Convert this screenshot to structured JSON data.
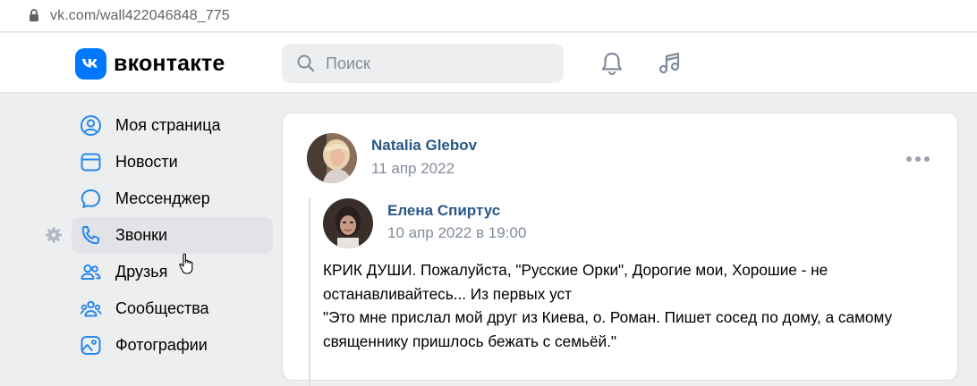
{
  "browser": {
    "url": "vk.com/wall422046848_775"
  },
  "header": {
    "logo_text": "вконтакте",
    "search_placeholder": "Поиск"
  },
  "sidebar": {
    "items": [
      {
        "label": "Моя страница",
        "icon": "user-circle-icon"
      },
      {
        "label": "Новости",
        "icon": "news-icon"
      },
      {
        "label": "Мессенджер",
        "icon": "message-bubble-icon"
      },
      {
        "label": "Звонки",
        "icon": "phone-icon"
      },
      {
        "label": "Друзья",
        "icon": "friends-icon"
      },
      {
        "label": "Сообщества",
        "icon": "communities-icon"
      },
      {
        "label": "Фотографии",
        "icon": "photo-icon"
      }
    ]
  },
  "post": {
    "author": "Natalia Glebov",
    "date": "11 апр 2022",
    "repost": {
      "author": "Елена Спиртус",
      "date": "10 апр 2022 в 19:00",
      "text_lines": [
        "КРИК ДУШИ. Пожалуйста, \"Русские Орки\", Дорогие мои, Хорошие - не",
        "останавливайтесь... Из первых уст",
        "\"Это мне прислал мой друг из Киева, о. Роман. Пишет сосед по дому, а самому",
        "священнику пришлось бежать с семьёй.\""
      ]
    }
  },
  "colors": {
    "brand": "#0077ff",
    "link": "#2a5885",
    "muted": "#818c99"
  }
}
